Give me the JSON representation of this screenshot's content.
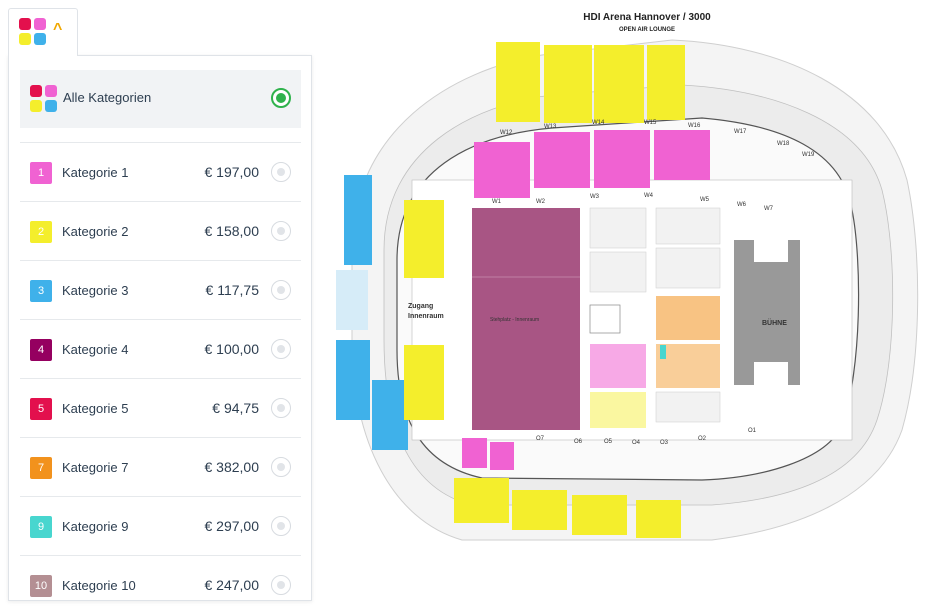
{
  "toggle": {
    "chevron_icon": "chevron-up-icon"
  },
  "all_categories": {
    "label": "Alle Kategorien",
    "selected": true
  },
  "categories": [
    {
      "num": "1",
      "name": "Kategorie 1",
      "price": "€ 197,00",
      "color": "#f062d2"
    },
    {
      "num": "2",
      "name": "Kategorie 2",
      "price": "€ 158,00",
      "color": "#f4ee2c"
    },
    {
      "num": "3",
      "name": "Kategorie 3",
      "price": "€ 117,75",
      "color": "#3fb1ea"
    },
    {
      "num": "4",
      "name": "Kategorie 4",
      "price": "€ 100,00",
      "color": "#950060"
    },
    {
      "num": "5",
      "name": "Kategorie 5",
      "price": "€ 94,75",
      "color": "#e3104d"
    },
    {
      "num": "7",
      "name": "Kategorie 7",
      "price": "€ 382,00",
      "color": "#f2921d"
    },
    {
      "num": "9",
      "name": "Kategorie 9",
      "price": "€ 297,00",
      "color": "#48d6cf"
    },
    {
      "num": "10",
      "name": "Kategorie 10",
      "price": "€ 247,00",
      "color": "#b48f93"
    }
  ],
  "map": {
    "title": "HDI Arena Hannover / 3000",
    "subtitle": "OPEN AIR LOUNGE",
    "stage_label": "BÜHNE",
    "standing_label": "Stehplatz - Innenraum",
    "entrance_label_1": "Zugang",
    "entrance_label_2": "Innenraum",
    "block_labels_top": [
      "W12",
      "W13",
      "W14",
      "W15",
      "W16",
      "W17",
      "W18",
      "W19"
    ],
    "block_labels_inner": [
      "W1",
      "W2",
      "W3",
      "W4",
      "W5",
      "W6",
      "W7"
    ],
    "block_labels_bottom": [
      "O7",
      "O6",
      "O5",
      "O4",
      "O3",
      "O2",
      "O1"
    ]
  }
}
